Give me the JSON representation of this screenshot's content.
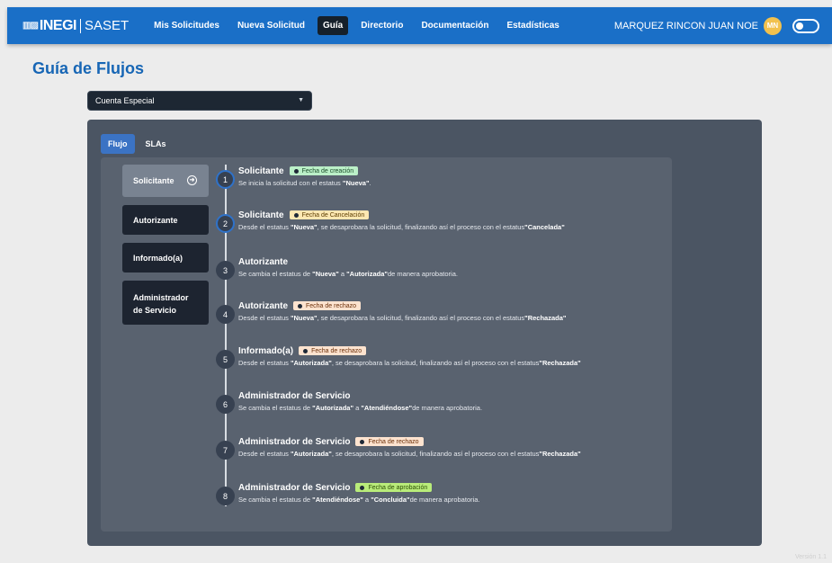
{
  "navbar": {
    "brand_mark": "INEGI",
    "brand_name": "SASET",
    "links": [
      "Mis Solicitudes",
      "Nueva Solicitud",
      "Guía",
      "Directorio",
      "Documentación",
      "Estadísticas"
    ],
    "active_link": "Guía",
    "user_name": "MARQUEZ RINCON JUAN NOE",
    "user_initials": "MN"
  },
  "page": {
    "title": "Guía de Flujos",
    "flow_select_value": "Cuenta Especial",
    "tabs": [
      "Flujo",
      "SLAs"
    ],
    "active_tab": "Flujo",
    "version_text": "Versión 1.1"
  },
  "roles": [
    {
      "label": "Solicitante",
      "active": true,
      "icon": "arrow-right-circle-icon"
    },
    {
      "label": "Autorizante",
      "active": false
    },
    {
      "label": "Informado(a)",
      "active": false
    },
    {
      "label": "Administrador de Servicio",
      "active": false
    }
  ],
  "steps": [
    {
      "num": "1",
      "title": "Solicitante",
      "badge": "Fecha de creación",
      "badge_type": "creacion",
      "desc": [
        {
          "t": "Se inicia la solicitud con el estatus "
        },
        {
          "b": "\"Nueva\""
        },
        {
          "t": "."
        }
      ]
    },
    {
      "num": "2",
      "title": "Solicitante",
      "badge": "Fecha de Cancelación",
      "badge_type": "cancel",
      "desc": [
        {
          "t": "Desde el estatus "
        },
        {
          "b": "\"Nueva\""
        },
        {
          "t": ", se desaprobara la solicitud, finalizando así el proceso con el estatus"
        },
        {
          "b": "\"Cancelada\""
        }
      ]
    },
    {
      "num": "3",
      "title": "Autorizante",
      "badge": "",
      "badge_type": "",
      "desc": [
        {
          "t": "Se cambia el estatus de "
        },
        {
          "b": "\"Nueva\""
        },
        {
          "t": " a "
        },
        {
          "b": "\"Autorizada\""
        },
        {
          "t": "de manera aprobatoria."
        }
      ]
    },
    {
      "num": "4",
      "title": "Autorizante",
      "badge": "Fecha de rechazo",
      "badge_type": "rechazo",
      "desc": [
        {
          "t": "Desde el estatus "
        },
        {
          "b": "\"Nueva\""
        },
        {
          "t": ", se desaprobara la solicitud, finalizando así el proceso con el estatus"
        },
        {
          "b": "\"Rechazada\""
        }
      ]
    },
    {
      "num": "5",
      "title": "Informado(a)",
      "badge": "Fecha de rechazo",
      "badge_type": "rechazo",
      "desc": [
        {
          "t": "Desde el estatus "
        },
        {
          "b": "\"Autorizada\""
        },
        {
          "t": ", se desaprobara la solicitud, finalizando así el proceso con el estatus"
        },
        {
          "b": "\"Rechazada\""
        }
      ]
    },
    {
      "num": "6",
      "title": "Administrador de Servicio",
      "badge": "",
      "badge_type": "",
      "desc": [
        {
          "t": "Se cambia el estatus de "
        },
        {
          "b": "\"Autorizada\""
        },
        {
          "t": " a "
        },
        {
          "b": "\"Atendiéndose\""
        },
        {
          "t": "de manera aprobatoria."
        }
      ]
    },
    {
      "num": "7",
      "title": "Administrador de Servicio",
      "badge": "Fecha de rechazo",
      "badge_type": "rechazo",
      "desc": [
        {
          "t": "Desde el estatus "
        },
        {
          "b": "\"Autorizada\""
        },
        {
          "t": ", se desaprobara la solicitud, finalizando así el proceso con el estatus"
        },
        {
          "b": "\"Rechazada\""
        }
      ]
    },
    {
      "num": "8",
      "title": "Administrador de Servicio",
      "badge": "Fecha de aprobación",
      "badge_type": "aprob",
      "desc": [
        {
          "t": "Se cambia el estatus de "
        },
        {
          "b": "\"Atendiéndose\""
        },
        {
          "t": " a "
        },
        {
          "b": "\"Concluida\""
        },
        {
          "t": "de manera aprobatoria."
        }
      ]
    }
  ],
  "colors": {
    "navbar": "#1a6fc7",
    "title": "#1766b5",
    "card": "#4b5563",
    "active_tab": "#3b73c4"
  }
}
